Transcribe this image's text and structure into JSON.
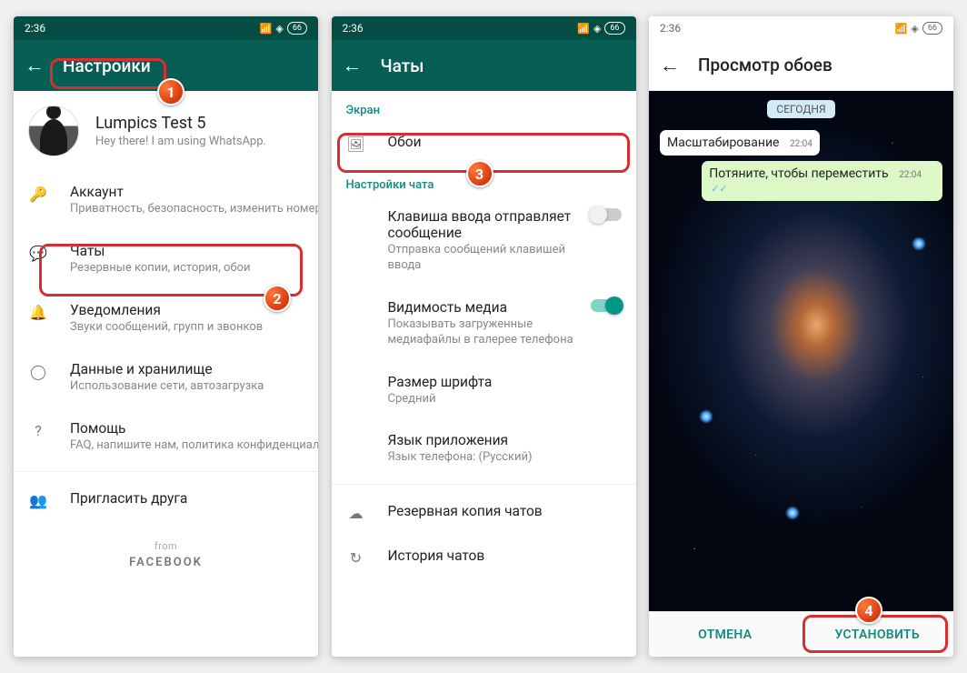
{
  "status": {
    "time": "2:36",
    "battery": "66"
  },
  "screen1": {
    "header_title": "Настройки",
    "profile_name": "Lumpics Test 5",
    "profile_status": "Hey there! I am using WhatsApp.",
    "items": {
      "account": {
        "title": "Аккаунт",
        "sub": "Приватность, безопасность, изменить номер"
      },
      "chats": {
        "title": "Чаты",
        "sub": "Резервные копии, история, обои"
      },
      "notif": {
        "title": "Уведомления",
        "sub": "Звуки сообщений, групп и звонков"
      },
      "data": {
        "title": "Данные и хранилище",
        "sub": "Использование сети, автозагрузка"
      },
      "help": {
        "title": "Помощь",
        "sub": "FAQ, напишите нам, политика конфиденциальн..."
      },
      "invite": {
        "title": "Пригласить друга"
      }
    },
    "from_label": "from",
    "fb_label": "FACEBOOK"
  },
  "screen2": {
    "header_title": "Чаты",
    "section_screen": "Экран",
    "wallpaper": "Обои",
    "section_chat": "Настройки чата",
    "enter": {
      "title": "Клавиша ввода отправляет сообщение",
      "sub": "Отправка сообщений клавишей ввода"
    },
    "media": {
      "title": "Видимость медиа",
      "sub": "Показывать загруженные медиафайлы в галерее телефона"
    },
    "font": {
      "title": "Размер шрифта",
      "sub": "Средний"
    },
    "lang": {
      "title": "Язык приложения",
      "sub": "Язык телефона: (Русский)"
    },
    "backup": "Резервная копия чатов",
    "history": "История чатов"
  },
  "screen3": {
    "header_title": "Просмотр обоев",
    "date_chip": "СЕГОДНЯ",
    "msg_in": "Масштабирование",
    "msg_out": "Потяните, чтобы переместить",
    "msg_time": "22:04",
    "btn_cancel": "ОТМЕНА",
    "btn_set": "УСТАНОВИТЬ"
  }
}
